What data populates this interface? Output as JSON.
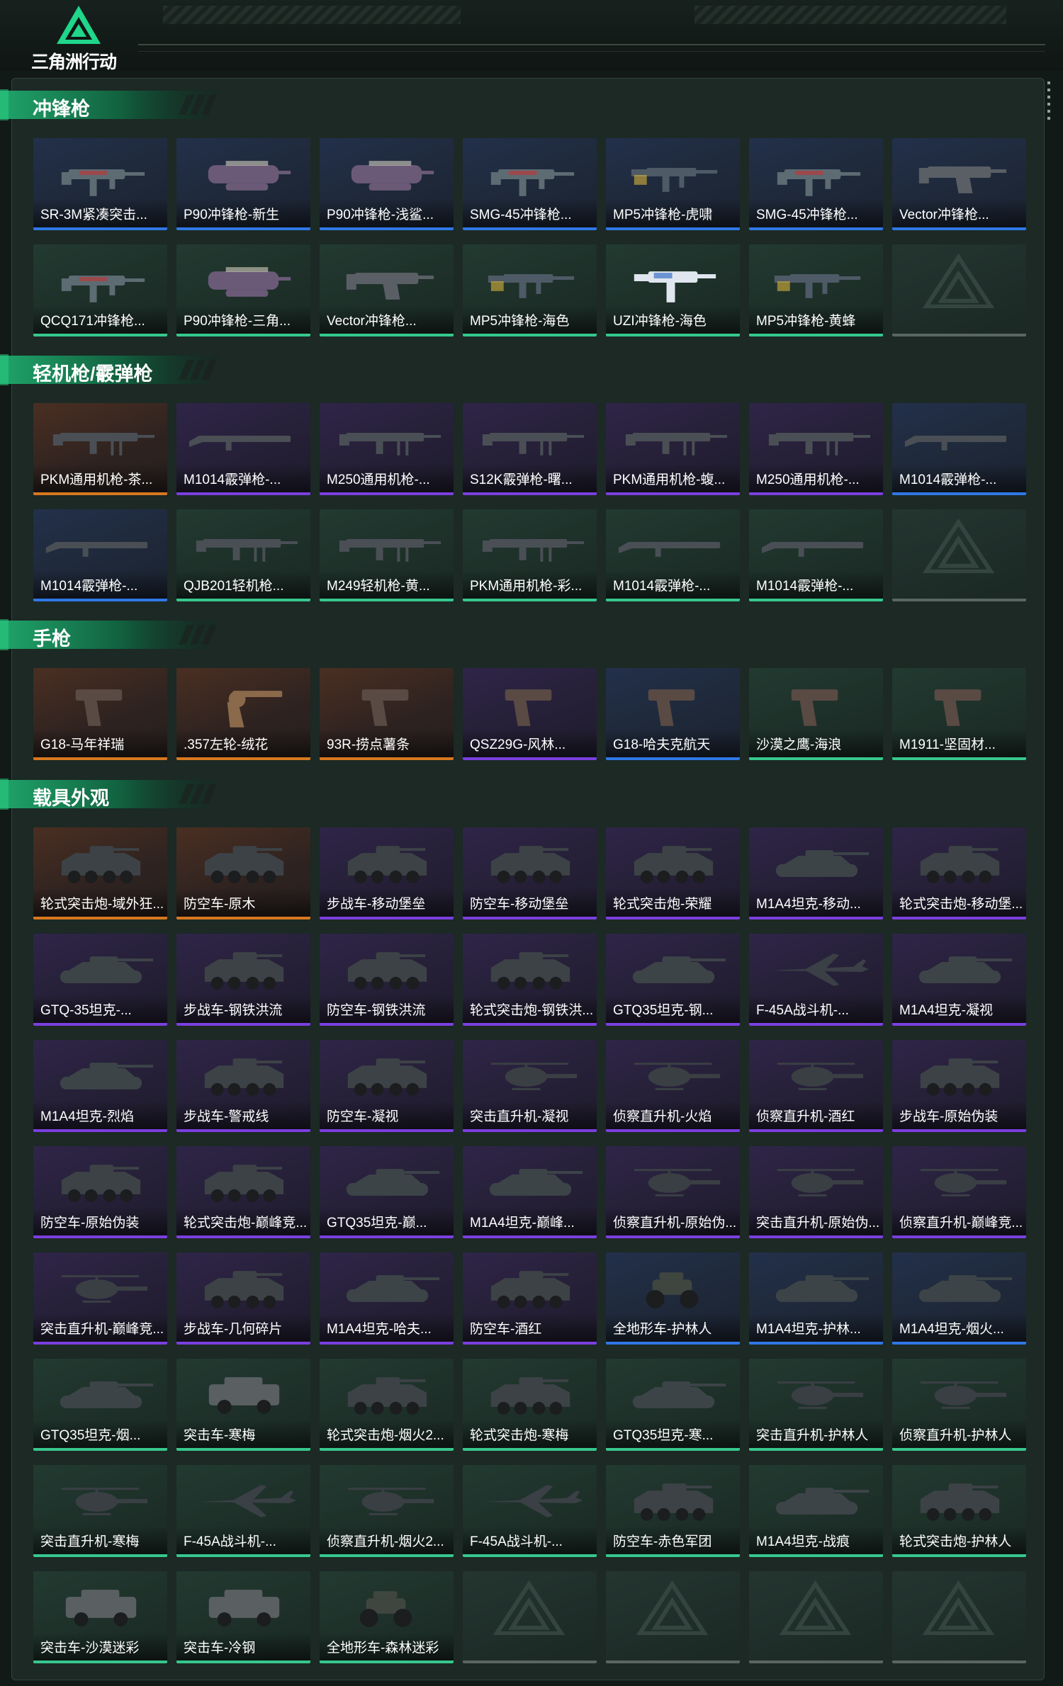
{
  "app": {
    "logo_text": "三角洲行动",
    "logo_icon": "delta-triangle-icon"
  },
  "colors": {
    "gold": "#d8781f",
    "purple": "#7b3fe0",
    "blue": "#2f78e6",
    "green": "#37c78e",
    "empty": "#5a6661"
  },
  "sections": [
    {
      "title": "冲锋枪",
      "items": [
        {
          "label": "SR-3M紧凑突击...",
          "rarity": "blue",
          "art": "smg"
        },
        {
          "label": "P90冲锋枪-新生",
          "rarity": "blue",
          "art": "p90"
        },
        {
          "label": "P90冲锋枪-浅鲨...",
          "rarity": "blue",
          "art": "p90"
        },
        {
          "label": "SMG-45冲锋枪...",
          "rarity": "blue",
          "art": "smg"
        },
        {
          "label": "MP5冲锋枪-虎啸",
          "rarity": "blue",
          "art": "mp5"
        },
        {
          "label": "SMG-45冲锋枪...",
          "rarity": "blue",
          "art": "smg"
        },
        {
          "label": "Vector冲锋枪...",
          "rarity": "blue",
          "art": "vector"
        },
        {
          "label": "QCQ171冲锋枪...",
          "rarity": "green",
          "art": "smg"
        },
        {
          "label": "P90冲锋枪-三角...",
          "rarity": "green",
          "art": "p90"
        },
        {
          "label": "Vector冲锋枪...",
          "rarity": "green",
          "art": "vector"
        },
        {
          "label": "MP5冲锋枪-海色",
          "rarity": "green",
          "art": "mp5"
        },
        {
          "label": "UZI冲锋枪-海色",
          "rarity": "green",
          "art": "uzi"
        },
        {
          "label": "MP5冲锋枪-黄蜂",
          "rarity": "green",
          "art": "mp5"
        },
        {
          "label": "",
          "rarity": "empty",
          "art": "none"
        }
      ]
    },
    {
      "title": "轻机枪/霰弹枪",
      "items": [
        {
          "label": "PKM通用机枪-茶...",
          "rarity": "gold",
          "art": "lmg"
        },
        {
          "label": "M1014霰弹枪-...",
          "rarity": "purple",
          "art": "shotgun"
        },
        {
          "label": "M250通用机枪-...",
          "rarity": "purple",
          "art": "lmg"
        },
        {
          "label": "S12K霰弹枪-曙...",
          "rarity": "purple",
          "art": "lmg"
        },
        {
          "label": "PKM通用机枪-蝮...",
          "rarity": "purple",
          "art": "lmg"
        },
        {
          "label": "M250通用机枪-...",
          "rarity": "purple",
          "art": "lmg"
        },
        {
          "label": "M1014霰弹枪-...",
          "rarity": "blue",
          "art": "shotgun"
        },
        {
          "label": "M1014霰弹枪-...",
          "rarity": "blue",
          "art": "shotgun"
        },
        {
          "label": "QJB201轻机枪...",
          "rarity": "green",
          "art": "lmg"
        },
        {
          "label": "M249轻机枪-黄...",
          "rarity": "green",
          "art": "lmg"
        },
        {
          "label": "PKM通用机枪-彩...",
          "rarity": "green",
          "art": "lmg"
        },
        {
          "label": "M1014霰弹枪-...",
          "rarity": "green",
          "art": "shotgun"
        },
        {
          "label": "M1014霰弹枪-...",
          "rarity": "green",
          "art": "shotgun"
        },
        {
          "label": "",
          "rarity": "empty",
          "art": "none"
        }
      ]
    },
    {
      "title": "手枪",
      "items": [
        {
          "label": "G18-马年祥瑞",
          "rarity": "gold",
          "art": "pistol"
        },
        {
          "label": ".357左轮-绒花",
          "rarity": "gold",
          "art": "revolver"
        },
        {
          "label": "93R-捞点薯条",
          "rarity": "gold",
          "art": "pistol"
        },
        {
          "label": "QSZ29G-风林...",
          "rarity": "purple",
          "art": "pistol"
        },
        {
          "label": "G18-哈夫克航天",
          "rarity": "blue",
          "art": "pistol"
        },
        {
          "label": "沙漠之鹰-海浪",
          "rarity": "green",
          "art": "pistol"
        },
        {
          "label": "M1911-坚固材...",
          "rarity": "green",
          "art": "pistol"
        }
      ]
    },
    {
      "title": "载具外观",
      "items": [
        {
          "label": "轮式突击炮-域外狂...",
          "rarity": "gold",
          "art": "apc"
        },
        {
          "label": "防空车-原木",
          "rarity": "gold",
          "art": "apc"
        },
        {
          "label": "步战车-移动堡垒",
          "rarity": "purple",
          "art": "apc"
        },
        {
          "label": "防空车-移动堡垒",
          "rarity": "purple",
          "art": "apc"
        },
        {
          "label": "轮式突击炮-荣耀",
          "rarity": "purple",
          "art": "apc"
        },
        {
          "label": "M1A4坦克-移动...",
          "rarity": "purple",
          "art": "tank"
        },
        {
          "label": "轮式突击炮-移动堡...",
          "rarity": "purple",
          "art": "apc"
        },
        {
          "label": "GTQ-35坦克-...",
          "rarity": "purple",
          "art": "tank"
        },
        {
          "label": "步战车-钢铁洪流",
          "rarity": "purple",
          "art": "apc"
        },
        {
          "label": "防空车-钢铁洪流",
          "rarity": "purple",
          "art": "apc"
        },
        {
          "label": "轮式突击炮-钢铁洪...",
          "rarity": "purple",
          "art": "apc"
        },
        {
          "label": "GTQ35坦克-钢...",
          "rarity": "purple",
          "art": "tank"
        },
        {
          "label": "F-45A战斗机-...",
          "rarity": "purple",
          "art": "jet"
        },
        {
          "label": "M1A4坦克-凝视",
          "rarity": "purple",
          "art": "tank"
        },
        {
          "label": "M1A4坦克-烈焰",
          "rarity": "purple",
          "art": "tank"
        },
        {
          "label": "步战车-警戒线",
          "rarity": "purple",
          "art": "apc"
        },
        {
          "label": "防空车-凝视",
          "rarity": "purple",
          "art": "apc"
        },
        {
          "label": "突击直升机-凝视",
          "rarity": "purple",
          "art": "heli"
        },
        {
          "label": "侦察直升机-火焰",
          "rarity": "purple",
          "art": "heli"
        },
        {
          "label": "侦察直升机-酒红",
          "rarity": "purple",
          "art": "heli"
        },
        {
          "label": "步战车-原始伪装",
          "rarity": "purple",
          "art": "apc"
        },
        {
          "label": "防空车-原始伪装",
          "rarity": "purple",
          "art": "apc"
        },
        {
          "label": "轮式突击炮-巅峰竞...",
          "rarity": "purple",
          "art": "apc"
        },
        {
          "label": "GTQ35坦克-巅...",
          "rarity": "purple",
          "art": "tank"
        },
        {
          "label": "M1A4坦克-巅峰...",
          "rarity": "purple",
          "art": "tank"
        },
        {
          "label": "侦察直升机-原始伪...",
          "rarity": "purple",
          "art": "heli"
        },
        {
          "label": "突击直升机-原始伪...",
          "rarity": "purple",
          "art": "heli"
        },
        {
          "label": "侦察直升机-巅峰竞...",
          "rarity": "purple",
          "art": "heli"
        },
        {
          "label": "突击直升机-巅峰竞...",
          "rarity": "purple",
          "art": "heli"
        },
        {
          "label": "步战车-几何碎片",
          "rarity": "purple",
          "art": "apc"
        },
        {
          "label": "M1A4坦克-哈夫...",
          "rarity": "purple",
          "art": "tank"
        },
        {
          "label": "防空车-酒红",
          "rarity": "purple",
          "art": "apc"
        },
        {
          "label": "全地形车-护林人",
          "rarity": "blue",
          "art": "atv"
        },
        {
          "label": "M1A4坦克-护林...",
          "rarity": "blue",
          "art": "tank"
        },
        {
          "label": "M1A4坦克-烟火...",
          "rarity": "blue",
          "art": "tank"
        },
        {
          "label": "GTQ35坦克-烟...",
          "rarity": "green",
          "art": "tank"
        },
        {
          "label": "突击车-寒梅",
          "rarity": "green",
          "art": "truck"
        },
        {
          "label": "轮式突击炮-烟火2...",
          "rarity": "green",
          "art": "apc"
        },
        {
          "label": "轮式突击炮-寒梅",
          "rarity": "green",
          "art": "apc"
        },
        {
          "label": "GTQ35坦克-寒...",
          "rarity": "green",
          "art": "tank"
        },
        {
          "label": "突击直升机-护林人",
          "rarity": "green",
          "art": "heli"
        },
        {
          "label": "侦察直升机-护林人",
          "rarity": "green",
          "art": "heli"
        },
        {
          "label": "突击直升机-寒梅",
          "rarity": "green",
          "art": "heli"
        },
        {
          "label": "F-45A战斗机-...",
          "rarity": "green",
          "art": "jet"
        },
        {
          "label": "侦察直升机-烟火2...",
          "rarity": "green",
          "art": "heli"
        },
        {
          "label": "F-45A战斗机-...",
          "rarity": "green",
          "art": "jet"
        },
        {
          "label": "防空车-赤色军团",
          "rarity": "green",
          "art": "apc"
        },
        {
          "label": "M1A4坦克-战痕",
          "rarity": "green",
          "art": "tank"
        },
        {
          "label": "轮式突击炮-护林人",
          "rarity": "green",
          "art": "apc"
        },
        {
          "label": "突击车-沙漠迷彩",
          "rarity": "green",
          "art": "truck"
        },
        {
          "label": "突击车-冷钢",
          "rarity": "green",
          "art": "truck"
        },
        {
          "label": "全地形车-森林迷彩",
          "rarity": "green",
          "art": "atv"
        },
        {
          "label": "",
          "rarity": "empty",
          "art": "none"
        },
        {
          "label": "",
          "rarity": "empty",
          "art": "none"
        },
        {
          "label": "",
          "rarity": "empty",
          "art": "none"
        },
        {
          "label": "",
          "rarity": "empty",
          "art": "none"
        }
      ]
    }
  ]
}
